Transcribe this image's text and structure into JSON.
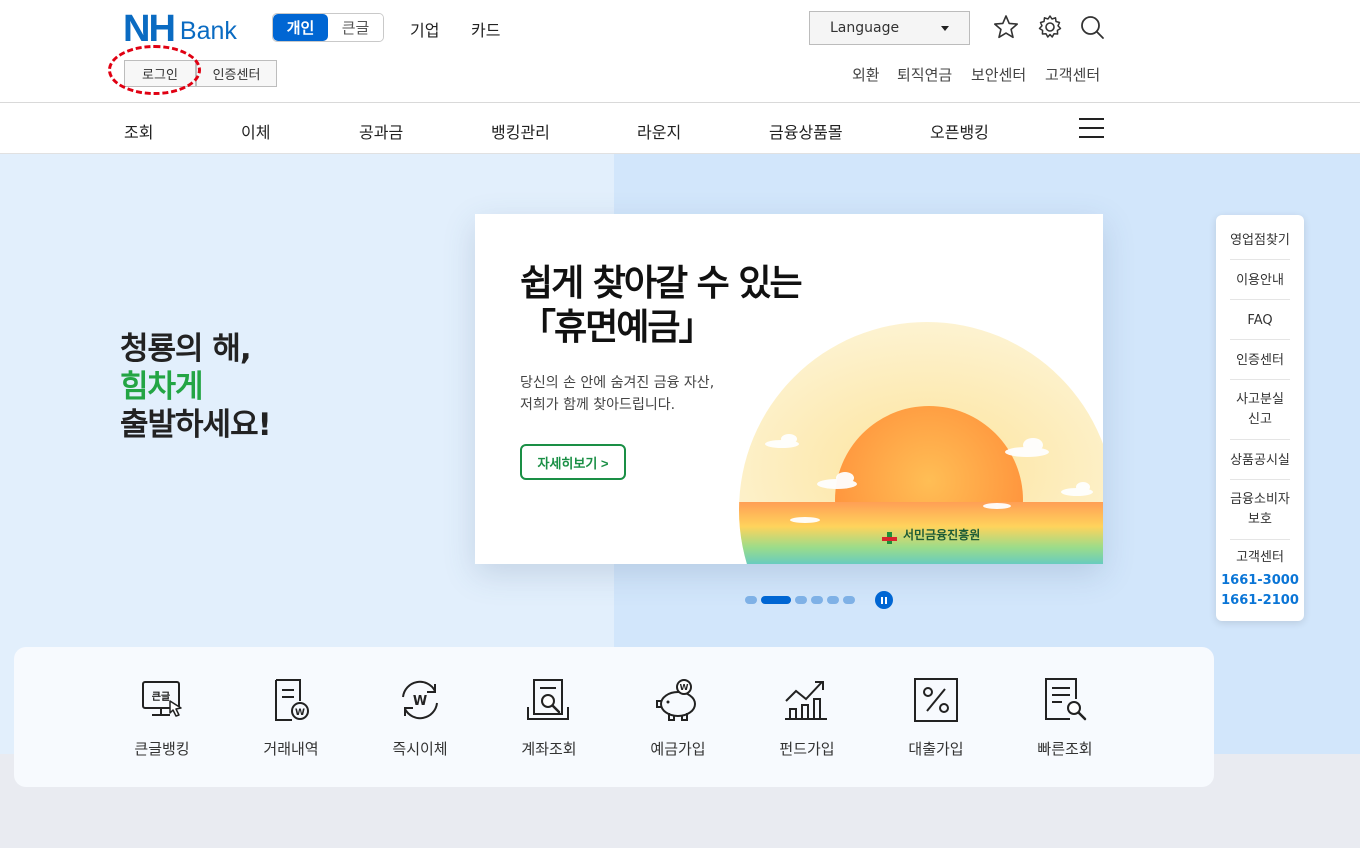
{
  "header": {
    "logo_nh": "NH",
    "logo_bank": "Bank",
    "tabs": {
      "personal": "개인",
      "large_text": "큰글"
    },
    "nav_links": {
      "corporate": "기업",
      "card": "카드"
    },
    "language_select": "Language",
    "login_button": "로그인",
    "cert_center_button": "인증센터",
    "util_links": [
      "외환",
      "퇴직연금",
      "보안센터",
      "고객센터"
    ],
    "icons": [
      "star-icon",
      "gear-icon",
      "search-icon"
    ]
  },
  "gnb": {
    "items": [
      "조회",
      "이체",
      "공과금",
      "뱅킹관리",
      "라운지",
      "금융상품몰",
      "오픈뱅킹"
    ],
    "menu_icon": "hamburger-menu-icon"
  },
  "visual": {
    "slogan_line1": "청룡의 해,",
    "slogan_line2": "힘차게",
    "slogan_line3": "출발하세요!",
    "banner": {
      "title_line1": "쉽게 찾아갈 수 있는",
      "title_line2": "「휴면예금」",
      "desc_line1": "당신의 손 안에 숨겨진 금융 자산,",
      "desc_line2": "저희가 함께 찾아드립니다.",
      "button": "자세히보기 >",
      "brand": "서민금융진흥원"
    },
    "slider": {
      "dot_count": 6,
      "active_index": 1,
      "pause_icon": "pause-icon"
    }
  },
  "quick_menu": {
    "items": [
      "영업점찾기",
      "이용안내",
      "FAQ",
      "인증센터",
      "사고분실",
      "신고",
      "상품공시실",
      "금융소비자",
      "보호"
    ],
    "customer_center": "고객센터",
    "phone1": "1661-3000",
    "phone2": "1661-2100"
  },
  "services": [
    {
      "label": "큰글뱅킹",
      "icon": "large-text-banking-icon",
      "badge": "큰글"
    },
    {
      "label": "거래내역",
      "icon": "transaction-history-icon"
    },
    {
      "label": "즉시이체",
      "icon": "instant-transfer-icon"
    },
    {
      "label": "계좌조회",
      "icon": "account-inquiry-icon"
    },
    {
      "label": "예금가입",
      "icon": "piggy-bank-icon"
    },
    {
      "label": "펀드가입",
      "icon": "fund-chart-icon"
    },
    {
      "label": "대출가입",
      "icon": "loan-percent-icon"
    },
    {
      "label": "빠른조회",
      "icon": "quick-search-icon"
    }
  ],
  "colors": {
    "brand_blue": "#0a6bc2",
    "accent_blue": "#0066d3",
    "green": "#23a544",
    "highlight_red": "#e00012"
  }
}
